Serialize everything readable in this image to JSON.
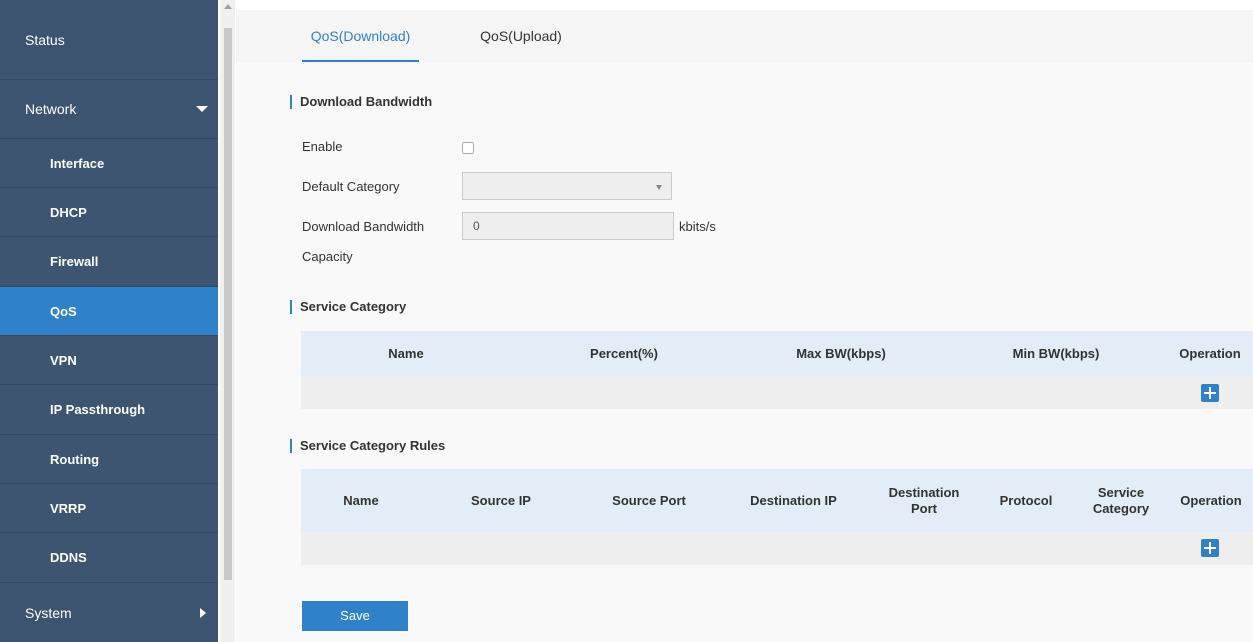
{
  "sidebar": {
    "status": "Status",
    "network": "Network",
    "items": [
      "Interface",
      "DHCP",
      "Firewall",
      "QoS",
      "VPN",
      "IP Passthrough",
      "Routing",
      "VRRP",
      "DDNS"
    ],
    "system": "System",
    "active_item": "QoS"
  },
  "tabs": [
    "QoS(Download)",
    "QoS(Upload)"
  ],
  "active_tab": "QoS(Download)",
  "download_bandwidth": {
    "title": "Download Bandwidth",
    "enable_label": "Enable",
    "enable_checked": false,
    "default_category_label": "Default Category",
    "default_category_value": "",
    "capacity_label_line1": "Download Bandwidth",
    "capacity_label_line2": "Capacity",
    "capacity_value": "0",
    "capacity_unit": "kbits/s"
  },
  "service_category": {
    "title": "Service Category",
    "columns": [
      "Name",
      "Percent(%)",
      "Max BW(kbps)",
      "Min BW(kbps)",
      "Operation"
    ]
  },
  "service_category_rules": {
    "title": "Service Category Rules",
    "columns": [
      "Name",
      "Source IP",
      "Source Port",
      "Destination IP",
      "Destination Port",
      "Protocol",
      "Service Category",
      "Operation"
    ]
  },
  "save_label": "Save",
  "colors": {
    "sidebar_bg": "#3d5470",
    "accent": "#2f82c9",
    "table_header": "#e2edf7"
  }
}
